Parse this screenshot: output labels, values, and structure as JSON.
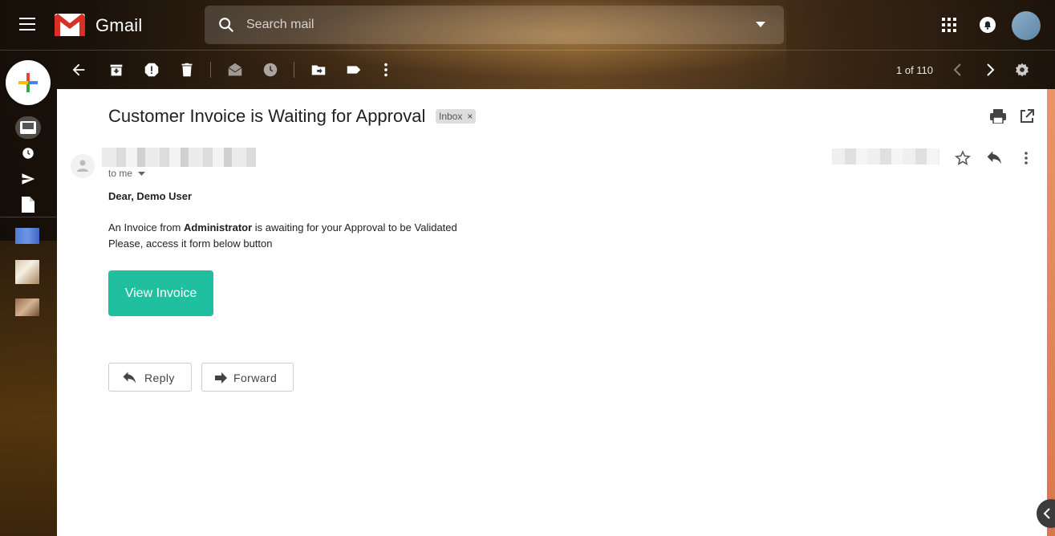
{
  "app": {
    "title": "Gmail"
  },
  "search": {
    "placeholder": "Search mail"
  },
  "topbar_icons": [
    "menu-icon",
    "search-icon",
    "dropdown-icon",
    "apps-icon",
    "notifications-icon",
    "avatar"
  ],
  "toolbar": {
    "icons": [
      "back-icon",
      "archive-icon",
      "report-spam-icon",
      "delete-icon",
      "mark-unread-icon",
      "snooze-icon",
      "move-to-icon",
      "label-icon",
      "more-icon"
    ],
    "pager": "1 of 110"
  },
  "left_rail": {
    "icons": [
      "compose-icon",
      "inbox-icon",
      "snoozed-icon",
      "sent-icon",
      "drafts-icon"
    ]
  },
  "message": {
    "subject": "Customer Invoice is Waiting for Approval",
    "label_chip": "Inbox",
    "chip_close": "×",
    "to_line": "to me",
    "greeting": "Dear, Demo User",
    "line1_prefix": "An Invoice from ",
    "line1_bold": "Administrator",
    "line1_suffix": " is awaiting for your Approval to be Validated",
    "line2": "Please, access it form below button",
    "cta": "View Invoice",
    "reply_button": "Reply",
    "forward_button": "Forward"
  },
  "colors": {
    "cta": "#1fbf9f",
    "accent_strip": "#e8956a",
    "panel": "#ffffff"
  }
}
